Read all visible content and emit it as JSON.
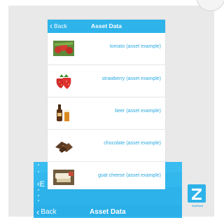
{
  "app": {
    "nav": {
      "back_label": "Back",
      "title": "Asset Data"
    },
    "items": [
      {
        "label": "tomato (asset example)",
        "icon": "tomato-image"
      },
      {
        "label": "strawberry (asset example)",
        "icon": "strawberry-image"
      },
      {
        "label": "beer (asset example)",
        "icon": "beer-image"
      },
      {
        "label": "chocolate (asset example)",
        "icon": "chocolate-image"
      },
      {
        "label": "goat cheese (asset example)",
        "icon": "goat-cheese-image"
      }
    ]
  },
  "background_stack": {
    "back_label": "Back",
    "title": "Asset Data",
    "ghost_back_glyph": "E"
  },
  "logo": {
    "caption": "ZeeFont"
  },
  "colors": {
    "accent": "#2eb3ea",
    "label": "#2aa9e0",
    "stage": "#e9e9e9"
  }
}
